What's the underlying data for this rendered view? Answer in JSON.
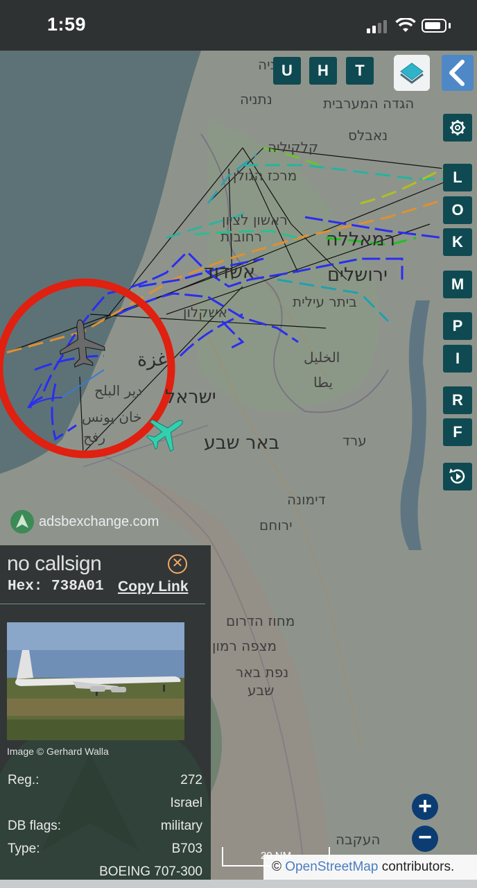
{
  "status_bar": {
    "time": "1:59"
  },
  "toolbar": {
    "buttons": [
      "U",
      "H",
      "T"
    ]
  },
  "side_buttons": [
    "L",
    "O",
    "K",
    "M",
    "P",
    "I",
    "R",
    "F"
  ],
  "map_labels": [
    {
      "text": "נתניה"
    },
    {
      "text": "הגדה המערבית"
    },
    {
      "text": "נאבלס"
    },
    {
      "text": "קלקיליה"
    },
    {
      "text": "מרכז הגולן"
    },
    {
      "text": "ראשון לציון"
    },
    {
      "text": "רחובות"
    },
    {
      "text": "רמאללה"
    },
    {
      "text": "אשדוד"
    },
    {
      "text": "ירושלים"
    },
    {
      "text": "ביתר עילית"
    },
    {
      "text": "אשקלון"
    },
    {
      "text": "غزة"
    },
    {
      "text": "الخليل"
    },
    {
      "text": "دير البلح"
    },
    {
      "text": "ישראל"
    },
    {
      "text": "يطا"
    },
    {
      "text": "خان يونس"
    },
    {
      "text": "رفح"
    },
    {
      "text": "באר שבע"
    },
    {
      "text": "ערד"
    },
    {
      "text": "דימונה"
    },
    {
      "text": "ירוחם"
    },
    {
      "text": "מחוז הדרום"
    },
    {
      "text": "מצפה רמון"
    },
    {
      "text": "נפת באר"
    },
    {
      "text": "שבע"
    },
    {
      "text": "העקבה"
    }
  ],
  "attribution": {
    "site": "adsbexchange.com"
  },
  "info_panel": {
    "callsign": "no callsign",
    "hex_label": "Hex:",
    "hex": "738A01",
    "hex_line": "Hex: 738A01",
    "copy_link": "Copy Link",
    "image_credit": "Image © Gerhard Walla",
    "fields": [
      {
        "label": "Reg.:",
        "value": "272"
      },
      {
        "label": "",
        "value": "Israel"
      },
      {
        "label": "DB flags:",
        "value": "military"
      },
      {
        "label": "Type:",
        "value": "B703"
      },
      {
        "label": "",
        "value": "BOEING 707-300"
      }
    ]
  },
  "scale": {
    "label": "20 NM"
  },
  "osm": {
    "prefix": "© ",
    "link": "OpenStreetMap",
    "suffix": " contributors."
  },
  "colors": {
    "sea": "#5d7276",
    "land": "#8d948c",
    "track_blue": "#2a2ef0",
    "highlight_ring": "#e02010",
    "other_aircraft": "#33d0b0",
    "button_bg": "#0f4a52"
  },
  "icons": [
    "signal-icon",
    "wifi-icon",
    "battery-icon",
    "layers-icon",
    "back-chevron-icon",
    "gear-icon",
    "replay-icon",
    "close-icon",
    "aircraft-icon",
    "zoom-in-icon",
    "zoom-out-icon",
    "adsbx-logo-icon"
  ]
}
